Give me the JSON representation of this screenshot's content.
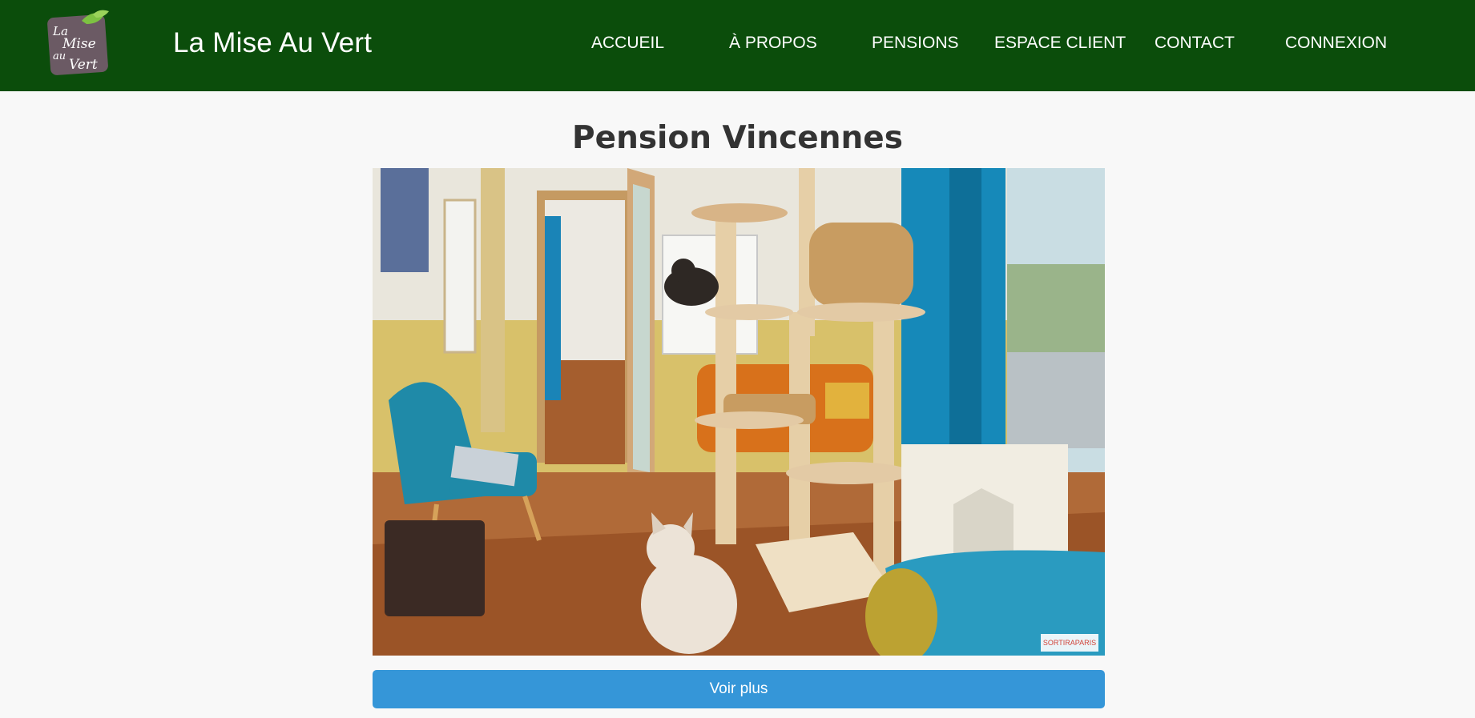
{
  "header": {
    "logo_lines": [
      "La",
      "Mise",
      "au",
      "Vert"
    ],
    "site_name": "La Mise Au Vert",
    "nav": [
      "ACCUEIL",
      "À PROPOS",
      "PENSIONS",
      "ESPACE CLIENT",
      "CONTACT",
      "CONNEXION"
    ],
    "background": "#0b4d0b"
  },
  "main": {
    "title": "Pension Vincennes",
    "photo_watermark": "SORTIRAPARIS",
    "button_label": "Voir plus",
    "button_color": "#3596d8"
  }
}
